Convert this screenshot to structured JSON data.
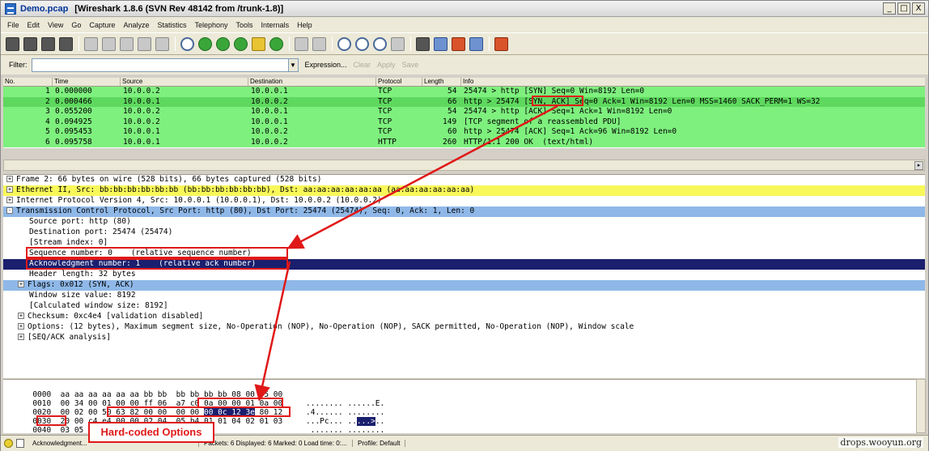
{
  "window": {
    "filename": "Demo.pcap",
    "title": "[Wireshark 1.8.6  (SVN Rev 48142 from /trunk-1.8)]",
    "btn_min": "_",
    "btn_max": "□",
    "btn_close": "X"
  },
  "menu": [
    "File",
    "Edit",
    "View",
    "Go",
    "Capture",
    "Analyze",
    "Statistics",
    "Telephony",
    "Tools",
    "Internals",
    "Help"
  ],
  "filter": {
    "label": "Filter:",
    "value": "",
    "dropdown_glyph": "▼",
    "expression": "Expression...",
    "clear": "Clear",
    "apply": "Apply",
    "save": "Save"
  },
  "packet_list": {
    "columns": [
      "No.",
      "Time",
      "Source",
      "Destination",
      "Protocol",
      "Length",
      "Info"
    ],
    "rows": [
      {
        "no": "1",
        "time": "0.000000",
        "src": "10.0.0.2",
        "dst": "10.0.0.1",
        "proto": "TCP",
        "len": "54",
        "info": "25474 > http [SYN] Seq=0 Win=8192 Len=0"
      },
      {
        "no": "2",
        "time": "0.000466",
        "src": "10.0.0.1",
        "dst": "10.0.0.2",
        "proto": "TCP",
        "len": "66",
        "info": "http > 25474 [SYN, ACK] Seq=0 Ack=1 Win=8192 Len=0 MSS=1460 SACK_PERM=1 WS=32"
      },
      {
        "no": "3",
        "time": "0.055200",
        "src": "10.0.0.2",
        "dst": "10.0.0.1",
        "proto": "TCP",
        "len": "54",
        "info": "25474 > http [ACK] Seq=1 Ack=1 Win=8192 Len=0"
      },
      {
        "no": "4",
        "time": "0.094925",
        "src": "10.0.0.2",
        "dst": "10.0.0.1",
        "proto": "TCP",
        "len": "149",
        "info": "[TCP segment of a reassembled PDU]"
      },
      {
        "no": "5",
        "time": "0.095453",
        "src": "10.0.0.1",
        "dst": "10.0.0.2",
        "proto": "TCP",
        "len": "60",
        "info": "http > 25474 [ACK] Seq=1 Ack=96 Win=8192 Len=0"
      },
      {
        "no": "6",
        "time": "0.095758",
        "src": "10.0.0.1",
        "dst": "10.0.0.2",
        "proto": "HTTP",
        "len": "260",
        "info": "HTTP/1.1 200 OK  (text/html)"
      }
    ]
  },
  "details": [
    {
      "text": "Frame 2: 66 bytes on wire (528 bits), 66 bytes captured (528 bits)",
      "expander": "+"
    },
    {
      "text": "Ethernet II, Src: bb:bb:bb:bb:bb:bb (bb:bb:bb:bb:bb:bb), Dst: aa:aa:aa:aa:aa:aa (aa:aa:aa:aa:aa:aa)",
      "expander": "+"
    },
    {
      "text": "Internet Protocol Version 4, Src: 10.0.0.1 (10.0.0.1), Dst: 10.0.0.2 (10.0.0.2)",
      "expander": "+"
    },
    {
      "text": "Transmission Control Protocol, Src Port: http (80), Dst Port: 25474 (25474), Seq: 0, Ack: 1, Len: 0",
      "expander": "-"
    },
    {
      "text": "Source port: http (80)"
    },
    {
      "text": "Destination port: 25474 (25474)"
    },
    {
      "text": "[Stream index: 0]"
    },
    {
      "text": "Sequence number: 0    (relative sequence number)"
    },
    {
      "text": "Acknowledgment number: 1    (relative ack number)"
    },
    {
      "text": "Header length: 32 bytes"
    },
    {
      "text": "Flags: 0x012 (SYN, ACK)",
      "expander": "+"
    },
    {
      "text": "Window size value: 8192"
    },
    {
      "text": "[Calculated window size: 8192]"
    },
    {
      "text": "Checksum: 0xc4e4 [validation disabled]",
      "expander": "+"
    },
    {
      "text": "Options: (12 bytes), Maximum segment size, No-Operation (NOP), No-Operation (NOP), SACK permitted, No-Operation (NOP), Window scale",
      "expander": "+"
    },
    {
      "text": "[SEQ/ACK analysis]",
      "expander": "+"
    }
  ],
  "hex": [
    {
      "offset": "0000",
      "pre": "aa aa aa aa aa aa bb bb  bb bb bb bb 08 00 45 00",
      "sel": "",
      "post": "",
      "ascii": "........ ......E."
    },
    {
      "offset": "0010",
      "pre": "00 34 00 01 00 00 ff 06  a7 c0 0a 00 00 01 0a 00",
      "sel": "",
      "post": "",
      "ascii": ".4...... ........"
    },
    {
      "offset": "0020",
      "pre": "00 02 00 50 63 82 00 00  00 00 ",
      "sel": "00 0c 12 3e",
      "post": " 80 12",
      "ascii_pre": "...Pc... ..",
      "ascii_sel": "...>",
      "ascii_post": ".."
    },
    {
      "offset": "0030",
      "pre": "20 00 c4 e4 00 00 02 04  05 b4 01 01 04 02 01 03",
      "sel": "",
      "post": "",
      "ascii": " ....... ........"
    },
    {
      "offset": "0040",
      "pre": "03 05",
      "sel": "",
      "post": "",
      "ascii": ".."
    }
  ],
  "status": {
    "expert": "Acknowledgment...",
    "packets": "Packets: 6 Displayed: 6 Marked: 0 Load time: 0:...",
    "profile": "Profile: Default"
  },
  "annotation": {
    "label": "Hard-coded Options"
  },
  "watermark": "drops.wooyun.org",
  "colors": {
    "tcp_row": "#7ef07e",
    "selected_detail": "#1a1f6e",
    "annotation": "#e01818"
  }
}
